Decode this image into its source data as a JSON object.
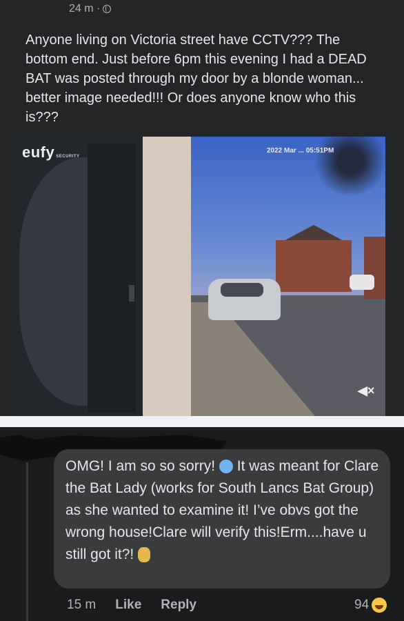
{
  "post": {
    "time": "24 m ·",
    "text": "Anyone living on Victoria street have CCTV??? The bottom end. Just before 6pm this evening I had a DEAD BAT was posted through my door by a blonde woman... better image needed!!! Or does anyone know who this is???",
    "privacy_icon": "globe-icon"
  },
  "photo": {
    "logo": "eufy",
    "logo_sub": "SECURITY",
    "timestamp": "2022 Mar ... 05:51PM",
    "mute_icon": "speaker-mute-icon"
  },
  "comment": {
    "text_part1": "OMG! I am so so sorry!",
    "text_part2": " It was meant for Clare the Bat Lady (works for South Lancs Bat Group) as she wanted to examine it! I’ve obvs got the wrong house!Clare will verify this!Erm....have u still got it?!",
    "emoji1": "screaming-face-emoji",
    "emoji2": "facepalm-emoji",
    "time": "15 m",
    "like_label": "Like",
    "reply_label": "Reply",
    "reaction_count": "94",
    "reaction_icon": "laughing-face-icon"
  },
  "colors": {
    "background": "#18191a",
    "post_bg": "#242526",
    "bubble_bg": "#3a3b3c",
    "text": "#e4e6eb",
    "muted": "#b0b3b8"
  }
}
